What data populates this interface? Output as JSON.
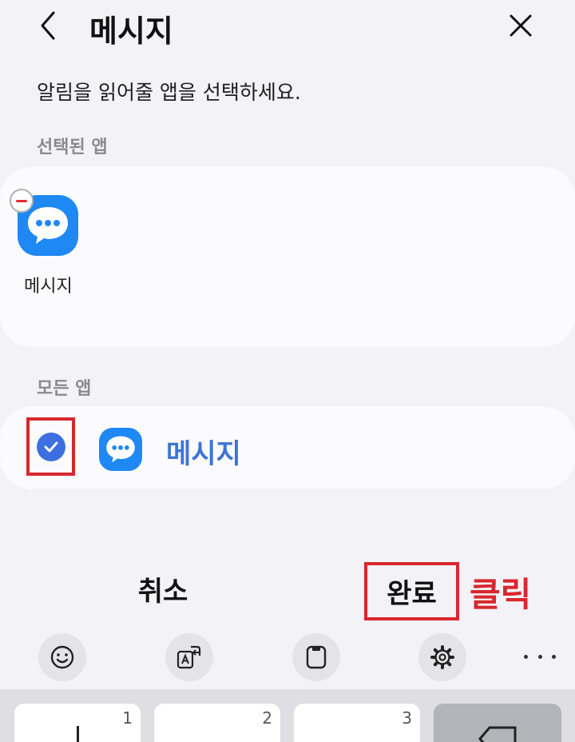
{
  "header": {
    "title": "메시지",
    "back_icon": "chevron-left-icon",
    "close_icon": "close-icon"
  },
  "instruction": "알림을 읽어줄 앱을 선택하세요.",
  "selected_section": {
    "label": "선택된 앱",
    "apps": [
      {
        "name": "메시지",
        "icon": "messages-app-icon",
        "badge": "remove-icon"
      }
    ]
  },
  "all_section": {
    "label": "모든 앱",
    "apps": [
      {
        "name": "메시지",
        "icon": "messages-app-icon",
        "checked": true
      }
    ]
  },
  "actions": {
    "cancel_label": "취소",
    "done_label": "완료",
    "annotation": "클릭"
  },
  "keyboard": {
    "toolbar": [
      "emoji-icon",
      "translate-icon",
      "clipboard-icon",
      "gear-icon",
      "more-icon"
    ],
    "keys": [
      "1",
      "2",
      "3"
    ]
  },
  "colors": {
    "accent_blue": "#3d75d6",
    "annotation_red": "#d9272e",
    "app_icon_blue": "#1e88f5"
  }
}
